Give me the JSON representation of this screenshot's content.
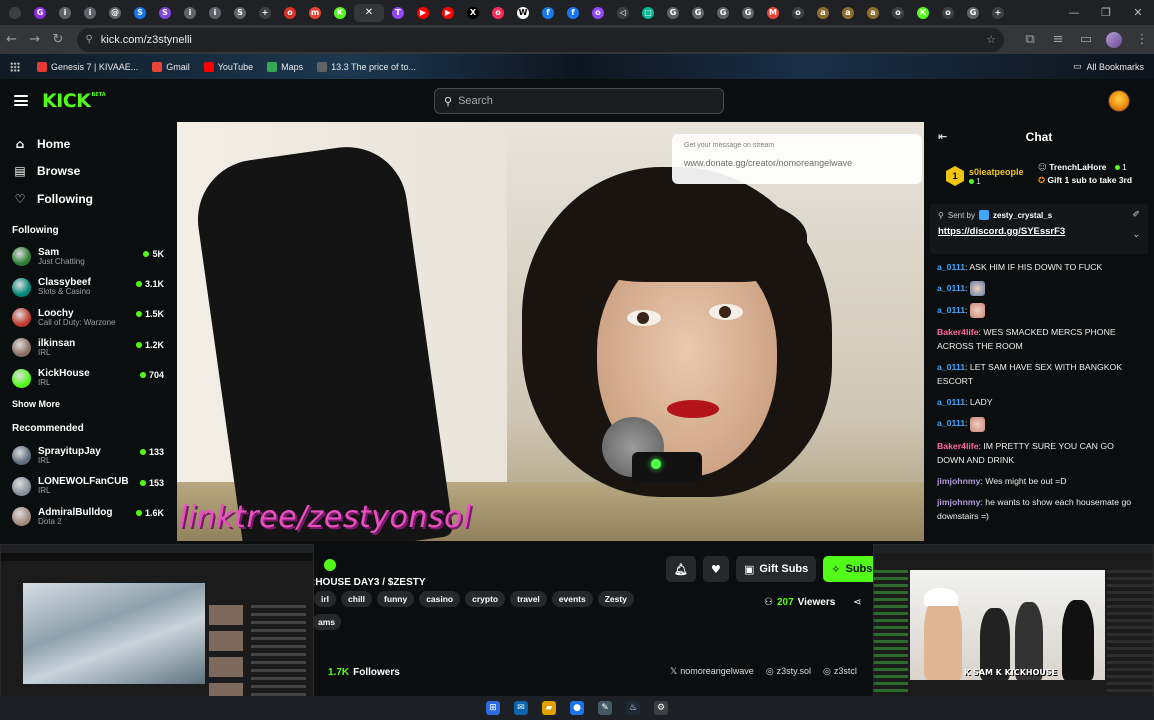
{
  "browser": {
    "url": "kick.com/z3stynelli",
    "tab_favicons": [
      {
        "letter": "",
        "color": "#3c4043"
      },
      {
        "letter": "G",
        "color": "#8e2de2"
      },
      {
        "letter": "i",
        "color": "#5f6368"
      },
      {
        "letter": "i",
        "color": "#5f6368"
      },
      {
        "letter": "@",
        "color": "#5f6368"
      },
      {
        "letter": "S",
        "color": "#1a73e8"
      },
      {
        "letter": "S",
        "color": "#7b47d8"
      },
      {
        "letter": "i",
        "color": "#5f6368"
      },
      {
        "letter": "i",
        "color": "#5f6368"
      },
      {
        "letter": "S",
        "color": "#5f6368"
      },
      {
        "letter": "+",
        "color": "#3c4043"
      },
      {
        "letter": "o",
        "color": "#d93025"
      },
      {
        "letter": "m",
        "color": "#ea4335"
      },
      {
        "letter": "K",
        "color": "#53fc18"
      },
      {
        "letter": "",
        "color": "#35363a"
      },
      {
        "letter": "T",
        "color": "#9146ff"
      },
      {
        "letter": "▶",
        "color": "#ff0000"
      },
      {
        "letter": "▶",
        "color": "#ff0000"
      },
      {
        "letter": "X",
        "color": "#000000"
      },
      {
        "letter": "o",
        "color": "#ff2d55"
      },
      {
        "letter": "W",
        "color": "#ffffff"
      },
      {
        "letter": "f",
        "color": "#1877f2"
      },
      {
        "letter": "f",
        "color": "#1877f2"
      },
      {
        "letter": "o",
        "color": "#9146ff"
      },
      {
        "letter": "◁",
        "color": "#3c4043"
      },
      {
        "letter": "□",
        "color": "#00b894"
      },
      {
        "letter": "G",
        "color": "#5f6368"
      },
      {
        "letter": "G",
        "color": "#5f6368"
      },
      {
        "letter": "G",
        "color": "#5f6368"
      },
      {
        "letter": "G",
        "color": "#5f6368"
      },
      {
        "letter": "M",
        "color": "#ea4335"
      },
      {
        "letter": "o",
        "color": "#3c4043"
      },
      {
        "letter": "a",
        "color": "#8d6e2e"
      },
      {
        "letter": "a",
        "color": "#8d6e2e"
      },
      {
        "letter": "a",
        "color": "#8d6e2e"
      },
      {
        "letter": "o",
        "color": "#3c4043"
      },
      {
        "letter": "K",
        "color": "#53fc18"
      },
      {
        "letter": "o",
        "color": "#3c4043"
      },
      {
        "letter": "G",
        "color": "#5f6368"
      },
      {
        "letter": "+",
        "color": "#3c4043"
      }
    ],
    "window_controls": [
      "—",
      "❐",
      "✕"
    ],
    "bookmarks": [
      {
        "label": "Genesis 7 | KIVAAE...",
        "color": "#e53935"
      },
      {
        "label": "Gmail",
        "color": "#ea4335"
      },
      {
        "label": "YouTube",
        "color": "#ff0000"
      },
      {
        "label": "Maps",
        "color": "#34a853"
      },
      {
        "label": "13.3 The price of to...",
        "color": "#5f6368"
      }
    ],
    "all_bookmarks": "All Bookmarks"
  },
  "header": {
    "logo": "KICK",
    "logo_badge": "BETA",
    "search_placeholder": "Search"
  },
  "sidebar": {
    "nav": [
      {
        "icon": "⌂",
        "label": "Home"
      },
      {
        "icon": "▤",
        "label": "Browse"
      },
      {
        "icon": "♡",
        "label": "Following"
      }
    ],
    "following_title": "Following",
    "following": [
      {
        "name": "Sam",
        "category": "Just Chatting",
        "viewers": "5K",
        "color": "#2e7d32"
      },
      {
        "name": "Classybeef",
        "category": "Slots & Casino",
        "viewers": "3.1K",
        "color": "#00897b"
      },
      {
        "name": "Loochy",
        "category": "Call of Duty: Warzone",
        "viewers": "1.5K",
        "color": "#c0392b"
      },
      {
        "name": "ilkinsan",
        "category": "IRL",
        "viewers": "1.2K",
        "color": "#8d6e63"
      },
      {
        "name": "KickHouse",
        "category": "IRL",
        "viewers": "704",
        "color": "#53fc18"
      }
    ],
    "show_more": "Show More",
    "recommended_title": "Recommended",
    "recommended": [
      {
        "name": "SprayitupJay",
        "category": "IRL",
        "viewers": "133",
        "color": "#5d6d7e"
      },
      {
        "name": "LONEWOLFanCUB",
        "category": "IRL",
        "viewers": "153",
        "color": "#85929e"
      },
      {
        "name": "AdmiralBulldog",
        "category": "Dota 2",
        "viewers": "1.6K",
        "color": "#a1887f"
      }
    ]
  },
  "video": {
    "overlay_small": "Get your message on stream",
    "overlay_url": "www.donate.gg/creator/nomoreangelwave",
    "linktree": "linktree/zestyonsol"
  },
  "chat": {
    "title": "Chat",
    "gifter": {
      "name": "s0ieatpeople",
      "count": "1",
      "rank": "1"
    },
    "leader": {
      "name": "TrenchLaHore",
      "count": "1",
      "promo": "Gift 1 sub to take 3rd"
    },
    "pinned_by": "Sent by",
    "pinned_user": "zesty_crystal_s",
    "pinned_link": "https://discord.gg/SYEssrF3",
    "messages": [
      {
        "user": "a_0111",
        "color": "#3ea6ff",
        "text": "ASK HIM IF HIS DOWN TO FUCK",
        "emote": ""
      },
      {
        "user": "a_0111",
        "color": "#3ea6ff",
        "text": "",
        "emote": "#5b7ea6"
      },
      {
        "user": "a_0111",
        "color": "#3ea6ff",
        "text": "",
        "emote": "#c8857a"
      },
      {
        "user": "Baker4life",
        "color": "#ff6b9d",
        "text": "WES SMACKED MERCS PHONE ACROSS THE ROOM",
        "emote": ""
      },
      {
        "user": "a_0111",
        "color": "#3ea6ff",
        "text": "LET SAM HAVE SEX WITH BANGKOK ESCORT",
        "emote": ""
      },
      {
        "user": "a_0111",
        "color": "#3ea6ff",
        "text": "LADY",
        "emote": ""
      },
      {
        "user": "a_0111",
        "color": "#3ea6ff",
        "text": "",
        "emote": "#c8857a"
      },
      {
        "user": "Baker4life",
        "color": "#ff6b9d",
        "text": "IM PRETTY SURE YOU CAN GO DOWN AND DRINK",
        "emote": ""
      },
      {
        "user": "jimjohnmy",
        "color": "#b39ddb",
        "text": "Wes might be out =D",
        "emote": ""
      },
      {
        "user": "jimjohnmy",
        "color": "#b39ddb",
        "text": "he wants to show each housemate go downstairs =)",
        "emote": ""
      }
    ]
  },
  "stream": {
    "title": ":HOUSE DAY3 / $ZESTY",
    "tags": [
      "irl",
      "chill",
      "funny",
      "casino",
      "crypto",
      "travel",
      "events",
      "Zesty"
    ],
    "tag_partial": "ams",
    "gift_subs": "Gift Subs",
    "subscribe": "Subsc",
    "viewers": "207",
    "viewers_label": "Viewers",
    "followers": "1.7K",
    "followers_label": "Followers",
    "socials": [
      "nomoreangelwave",
      "z3sty.sol",
      "z3stcl"
    ]
  },
  "pip_right": {
    "caption": "K SAM K KICKHOUSE"
  },
  "taskbar": [
    {
      "glyph": "⊞",
      "color": "#2d6cdf"
    },
    {
      "glyph": "✉",
      "color": "#0a64ad"
    },
    {
      "glyph": "▰",
      "color": "#e2a000"
    },
    {
      "glyph": "●",
      "color": "#1a73e8"
    },
    {
      "glyph": "✎",
      "color": "#455a64"
    },
    {
      "glyph": "♨",
      "color": "#1b2838"
    },
    {
      "glyph": "⚙",
      "color": "#3c4043"
    }
  ]
}
